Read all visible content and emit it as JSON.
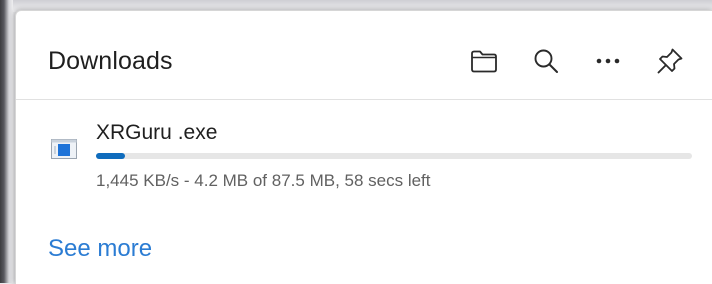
{
  "panel": {
    "title": "Downloads"
  },
  "toolbar": {
    "buttons": [
      {
        "name": "open-folder",
        "icon": "folder-icon"
      },
      {
        "name": "search",
        "icon": "search-icon"
      },
      {
        "name": "more-options",
        "icon": "ellipsis-icon"
      },
      {
        "name": "pin",
        "icon": "pin-icon"
      }
    ]
  },
  "download": {
    "file_name": "XRGuru .exe",
    "progress_fraction": 0.048,
    "status": "1,445 KB/s - 4.2 MB of 87.5 MB, 58 secs left",
    "icon": "exe-file-icon"
  },
  "footer": {
    "see_more": "See more"
  },
  "colors": {
    "accent": "#0f6cbd",
    "link": "#2b7cd3",
    "track": "#e6e6e6"
  }
}
